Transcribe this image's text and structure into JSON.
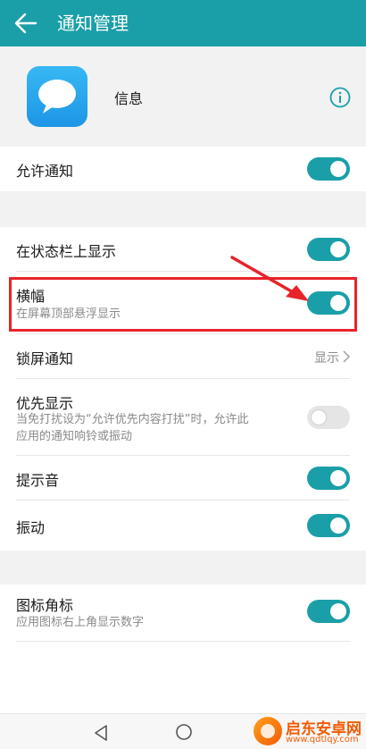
{
  "header": {
    "title": "通知管理",
    "back_icon": "arrow-left-icon"
  },
  "app": {
    "name": "信息",
    "icon": "chat-bubble-icon",
    "info_icon": "info-circle-icon"
  },
  "settings": {
    "allow": {
      "label": "允许通知",
      "on": true
    },
    "status_bar": {
      "label": "在状态栏上显示",
      "on": true
    },
    "banner": {
      "label": "横幅",
      "sub": "在屏幕顶部悬浮显示",
      "on": true
    },
    "lock_screen": {
      "label": "锁屏通知",
      "value": "显示"
    },
    "priority": {
      "label": "优先显示",
      "sub_line1": "当免打扰设为“允许优先内容打扰”时，允许此",
      "sub_line2": "应用的通知响铃或振动",
      "on": false
    },
    "sound": {
      "label": "提示音",
      "on": true
    },
    "vibrate": {
      "label": "振动",
      "on": true
    },
    "badge": {
      "label": "图标角标",
      "sub": "应用图标右上角显示数字",
      "on": true
    }
  },
  "colors": {
    "accent": "#1a9fa8",
    "highlight": "#e8232a"
  },
  "watermark": {
    "name": "启东安卓网",
    "url": "www.qdtlqy.com"
  }
}
